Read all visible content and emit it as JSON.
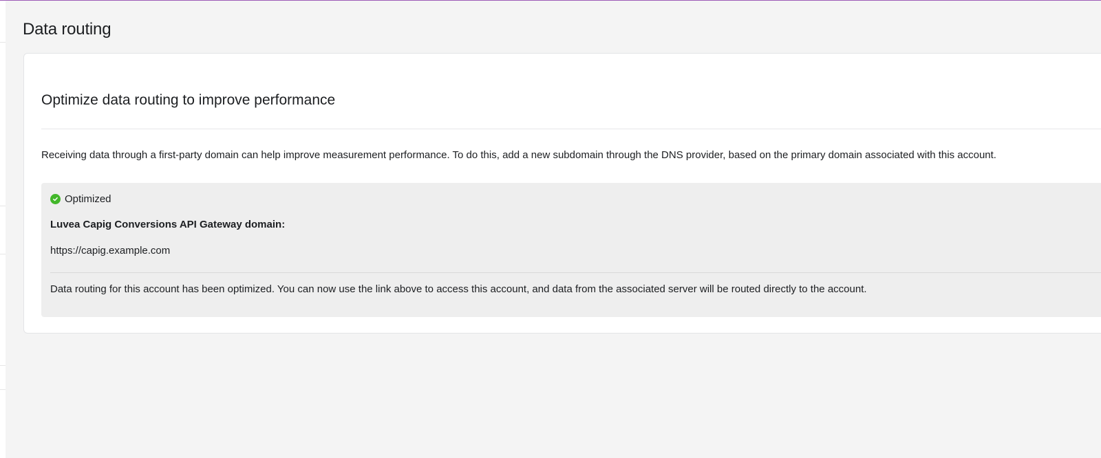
{
  "page": {
    "title": "Data routing"
  },
  "card": {
    "title": "Optimize data routing to improve performance",
    "description": "Receiving data through a first-party domain can help improve measurement performance. To do this, add a new subdomain through the DNS provider, based on the primary domain associated with this account."
  },
  "status_panel": {
    "status_icon": "check-circle-icon",
    "status_color": "#42b72a",
    "status_label": "Optimized",
    "domain_label": "Luvea Capig Conversions API Gateway domain:",
    "domain_url": "https://capig.example.com",
    "note": "Data routing for this account has been optimized. You can now use the link above to access this account, and data from the associated server will be routed directly to the account."
  },
  "colors": {
    "accent": "#9b59b6",
    "background": "#f4f4f4",
    "panel": "#eeeeee"
  }
}
